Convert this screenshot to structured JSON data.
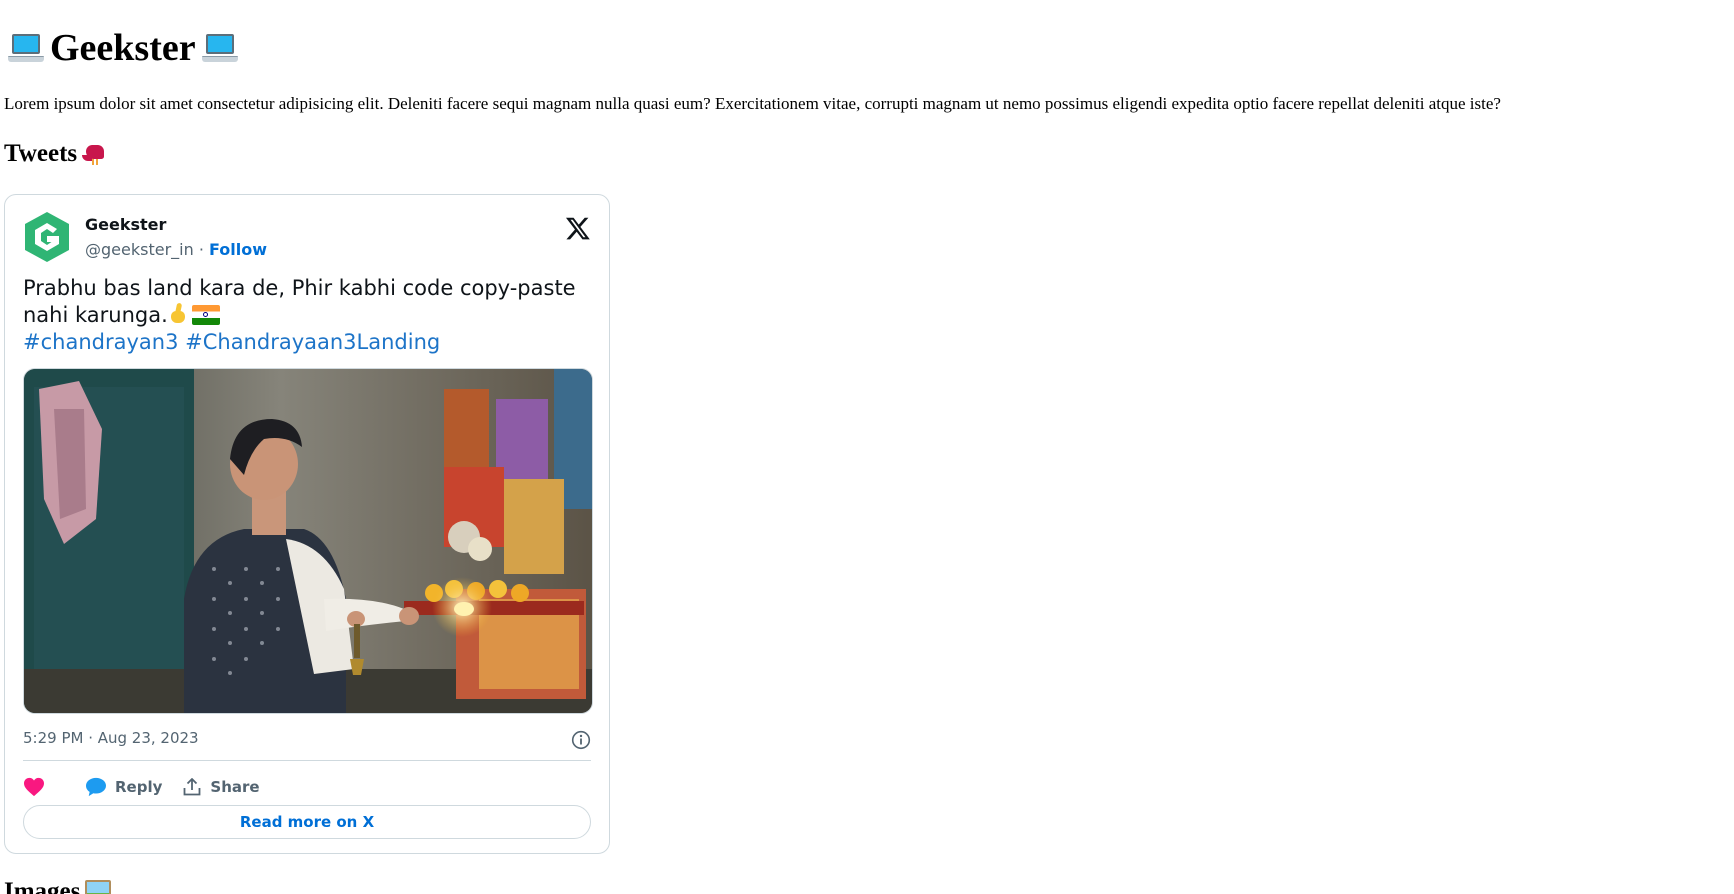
{
  "page": {
    "title": "Geekster",
    "title_icon": "laptop-icon",
    "intro": "Lorem ipsum dolor sit amet consectetur adipisicing elit. Deleniti facere sequi magnam nulla quasi eum? Exercitationem vitae, corrupti magnam ut nemo possimus eligendi expedita optio facere repellat deleniti atque iste?"
  },
  "sections": {
    "tweets": {
      "heading": "Tweets",
      "icon": "bird-icon"
    },
    "images": {
      "heading": "Images",
      "icon": "image-icon"
    }
  },
  "tweet": {
    "author_name": "Geekster",
    "handle": "@geekster_in",
    "separator": " · ",
    "follow_label": "Follow",
    "text_line": "Prabhu bas land kara de, Phir kabhi code copy-paste nahi karunga.",
    "hashtag_1": "#chandrayan3",
    "hashtag_2": "#Chandrayaan3Landing",
    "timestamp": "5:29 PM · Aug 23, 2023",
    "like_label": "",
    "reply_label": "Reply",
    "share_label": "Share",
    "read_more_label": "Read more on X"
  },
  "colors": {
    "link": "#006fd6",
    "hashtag": "#1d74c8",
    "like": "#f91880",
    "reply": "#1d9bf0",
    "avatar_green": "#2fb574",
    "muted_text": "#536471"
  }
}
